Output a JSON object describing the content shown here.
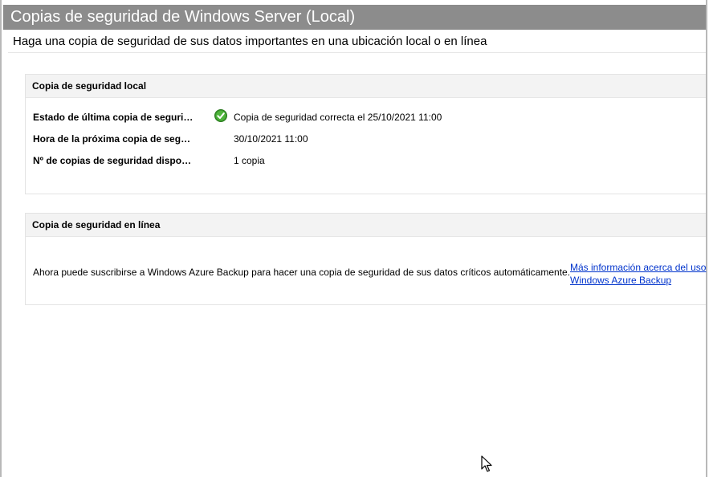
{
  "window": {
    "title": "Copias de seguridad de Windows Server (Local)",
    "subtitle": "Haga una copia de seguridad de sus datos importantes en una ubicación local o en línea"
  },
  "local_backup": {
    "header": "Copia de seguridad local",
    "rows": [
      {
        "label": "Estado de última copia de seguridad:",
        "value": "Copia de seguridad correcta el 25/10/2021 11:00",
        "icon": "green-check-icon"
      },
      {
        "label": "Hora de la próxima copia de seguri...",
        "value": "30/10/2021 11:00"
      },
      {
        "label": "Nº de copias de seguridad disponib...",
        "value": "1 copia"
      }
    ]
  },
  "online_backup": {
    "header": "Copia de seguridad en línea",
    "description": "Ahora puede suscribirse a Windows Azure Backup para hacer una copia de seguridad de sus datos críticos automáticamente.",
    "link_line1": "Más información acerca del uso",
    "link_line2": "Windows Azure Backup"
  },
  "colors": {
    "title_bar": "#8c8c8c",
    "panel_header": "#f3f3f3",
    "link": "#0033cc",
    "success": "#3a9a2c"
  }
}
